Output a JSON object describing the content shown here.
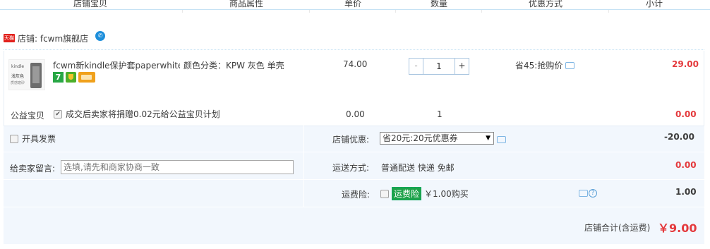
{
  "table_header": {
    "columns": [
      "店铺宝贝",
      "商品属性",
      "单价",
      "数量",
      "优惠方式",
      "小计"
    ]
  },
  "shop": {
    "badge": "天猫",
    "label": "店铺: fcwm旗舰店"
  },
  "item": {
    "thumb_text": [
      "kindle",
      "浅灰色",
      "质感磨砂"
    ],
    "title": "fcwm新kindle保护套paperwhite...",
    "badge_7": "7",
    "attribute": "颜色分类：KPW 灰色 单壳",
    "unit_price": "74.00",
    "quantity": "1",
    "qty_minus": "-",
    "qty_plus": "+",
    "promotion": "省45:抢购价",
    "subtotal": "29.00"
  },
  "charity": {
    "label": "公益宝贝",
    "check": "✔",
    "text": "成交后卖家将捐赠0.02元给公益宝贝计划",
    "price": "0.00",
    "qty": "1",
    "subtotal": "0.00"
  },
  "invoice": {
    "label": "开具发票"
  },
  "shop_discount": {
    "label": "店铺优惠:",
    "selected": "省20元:20元优惠券",
    "arrow": "▼",
    "amount": "-20.00"
  },
  "message": {
    "label": "给卖家留言:",
    "placeholder": "选填,请先和商家协商一致"
  },
  "shipping": {
    "label": "运送方式:",
    "value": "普通配送 快递 免邮",
    "amount": "0.00"
  },
  "insurance": {
    "label": "运费险:",
    "tag": "运费险",
    "text": "￥1.00购买",
    "help": "?",
    "amount": "1.00"
  },
  "total": {
    "label": "店铺合计(含运费)",
    "value": "￥9.00"
  },
  "colors": {
    "accent_red": "#e4393c",
    "panel_bg": "#f2f7fd",
    "border_blue": "#c6e2f4"
  }
}
